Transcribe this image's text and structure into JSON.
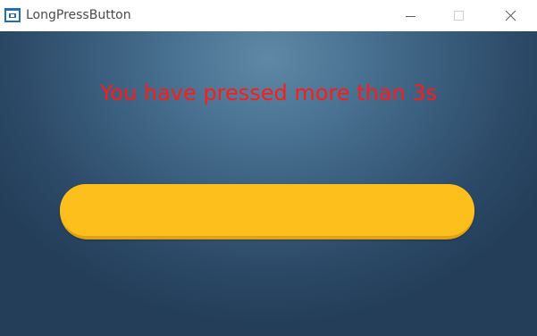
{
  "window": {
    "title": "LongPressButton",
    "app_icon": "app-window-icon",
    "controls": {
      "minimize_icon": "minimize-icon",
      "maximize_icon": "maximize-icon",
      "close_icon": "close-icon"
    }
  },
  "main": {
    "status_text": "You have pressed more than 3s",
    "status_color": "#ff1a1a",
    "background_color": "#375a79",
    "button": {
      "label": "",
      "color": "#fdbf1c"
    }
  }
}
